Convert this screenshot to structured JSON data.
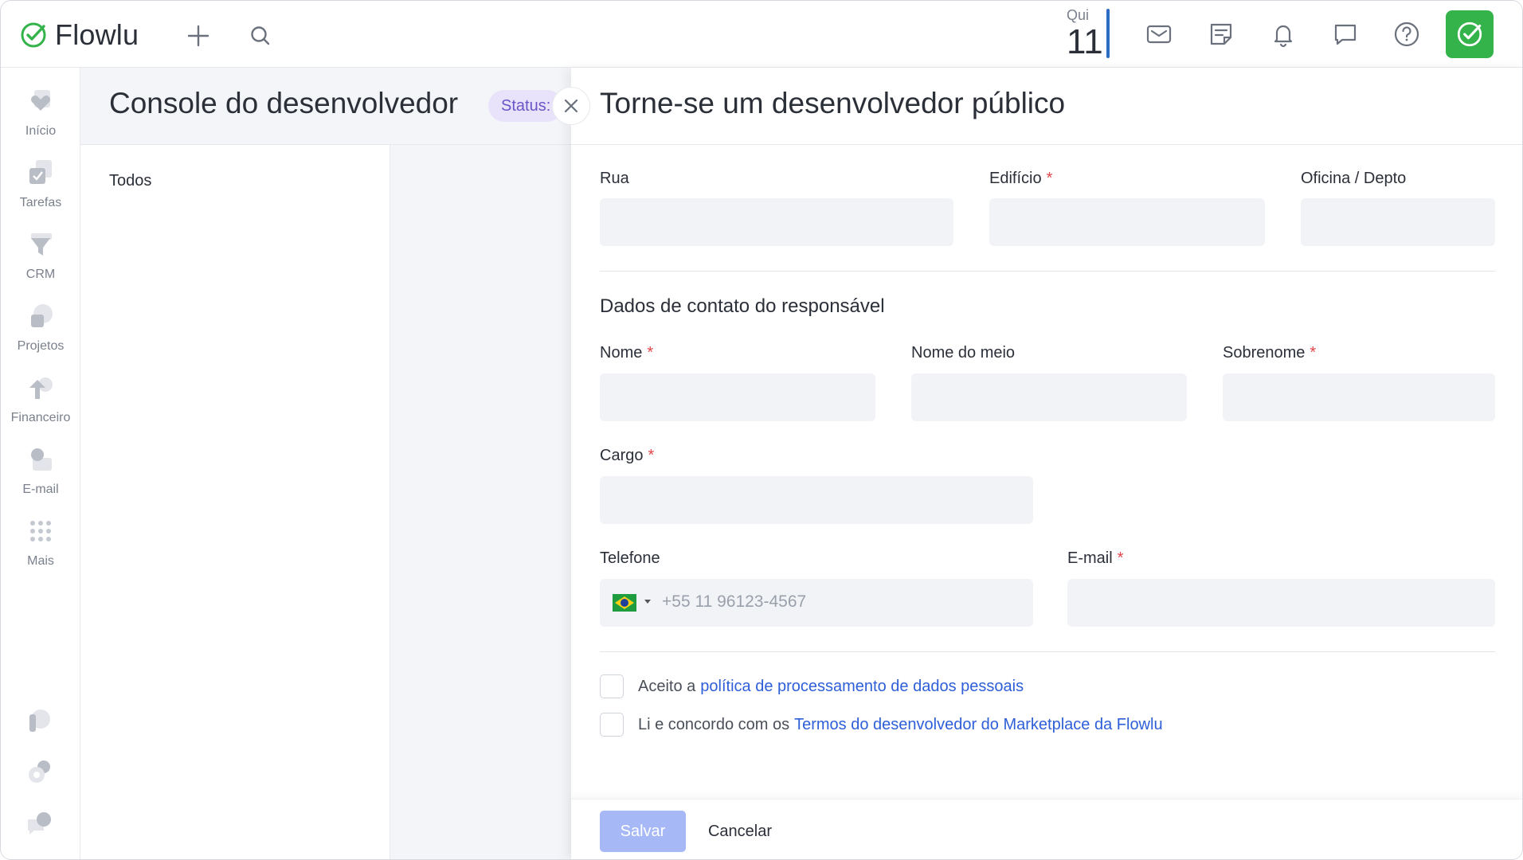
{
  "app": {
    "name": "Flowlu"
  },
  "topbar": {
    "date_weekday": "Qui",
    "date_number": "11",
    "icons": [
      "plus-icon",
      "search-icon",
      "mail-icon",
      "notes-icon",
      "bell-icon",
      "chat-icon",
      "help-icon"
    ]
  },
  "sidebar": {
    "items": [
      {
        "label": "Início",
        "icon": "home-heart-icon"
      },
      {
        "label": "Tarefas",
        "icon": "tasks-icon"
      },
      {
        "label": "CRM",
        "icon": "crm-funnel-icon"
      },
      {
        "label": "Projetos",
        "icon": "projects-icon"
      },
      {
        "label": "Financeiro",
        "icon": "finance-icon"
      },
      {
        "label": "E-mail",
        "icon": "email-icon"
      },
      {
        "label": "Mais",
        "icon": "grid-dots-icon"
      }
    ],
    "bottom_icons": [
      "parking-icon",
      "settings-gear-icon",
      "support-chat-icon"
    ]
  },
  "page": {
    "title": "Console do desenvolvedor",
    "status_label": "Status:",
    "filter_all": "Todos"
  },
  "panel": {
    "title": "Torne-se um desenvolvedor público",
    "address": {
      "street_label": "Rua",
      "building_label": "Edifício",
      "office_label": "Oficina / Depto"
    },
    "contact_section_title": "Dados de contato do responsável",
    "contact": {
      "first_name_label": "Nome",
      "middle_name_label": "Nome do meio",
      "last_name_label": "Sobrenome",
      "position_label": "Cargo",
      "phone_label": "Telefone",
      "phone_placeholder": "+55 11 96123-4567",
      "email_label": "E-mail"
    },
    "required_mark": "*",
    "consent": {
      "privacy_prefix": "Aceito a",
      "privacy_link": "política de processamento de dados pessoais",
      "terms_prefix": "Li e concordo com os",
      "terms_link": "Termos do desenvolvedor do Marketplace da Flowlu"
    },
    "footer": {
      "save_label": "Salvar",
      "cancel_label": "Cancelar"
    }
  },
  "colors": {
    "brand_green": "#34b34a",
    "link_blue": "#2e5fd8",
    "save_button_disabled": "#a6b8f5",
    "required_red": "#e0464b",
    "status_pill_bg": "#e8e3fa"
  }
}
